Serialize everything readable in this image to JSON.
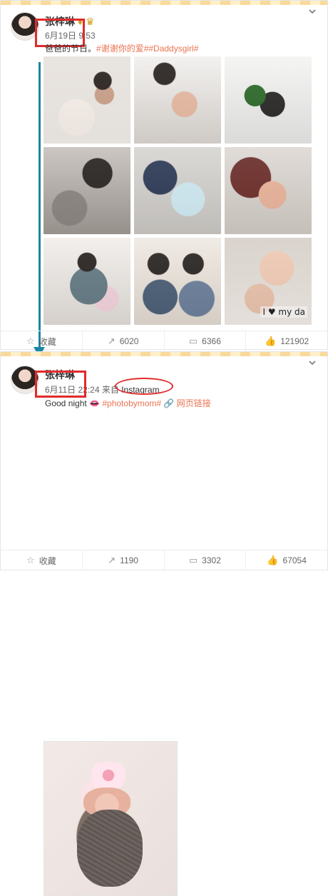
{
  "post1": {
    "author": "张梓琳",
    "date": "6月19日",
    "time": "9:53",
    "text_prefix": "爸爸的节日。",
    "hashtags": "#谢谢你的爱##Daddysgirl#",
    "actions": {
      "favorite": "收藏",
      "repost": "6020",
      "comment": "6366",
      "like": "121902"
    },
    "photo_caption": "I ♥ my da"
  },
  "post2": {
    "author": "张梓琳",
    "date": "6月11日",
    "time_suffix": "22:24 来自",
    "source": "Instagram",
    "text": "Good night",
    "hashtag": "#photobymom#",
    "link": "网页链接",
    "actions": {
      "favorite": "收藏",
      "repost": "1190",
      "comment": "3302",
      "like": "67054"
    }
  },
  "colors": {
    "accent": "#eb7350",
    "highlight": "#e02b2b",
    "arrow": "#1b86a3"
  }
}
